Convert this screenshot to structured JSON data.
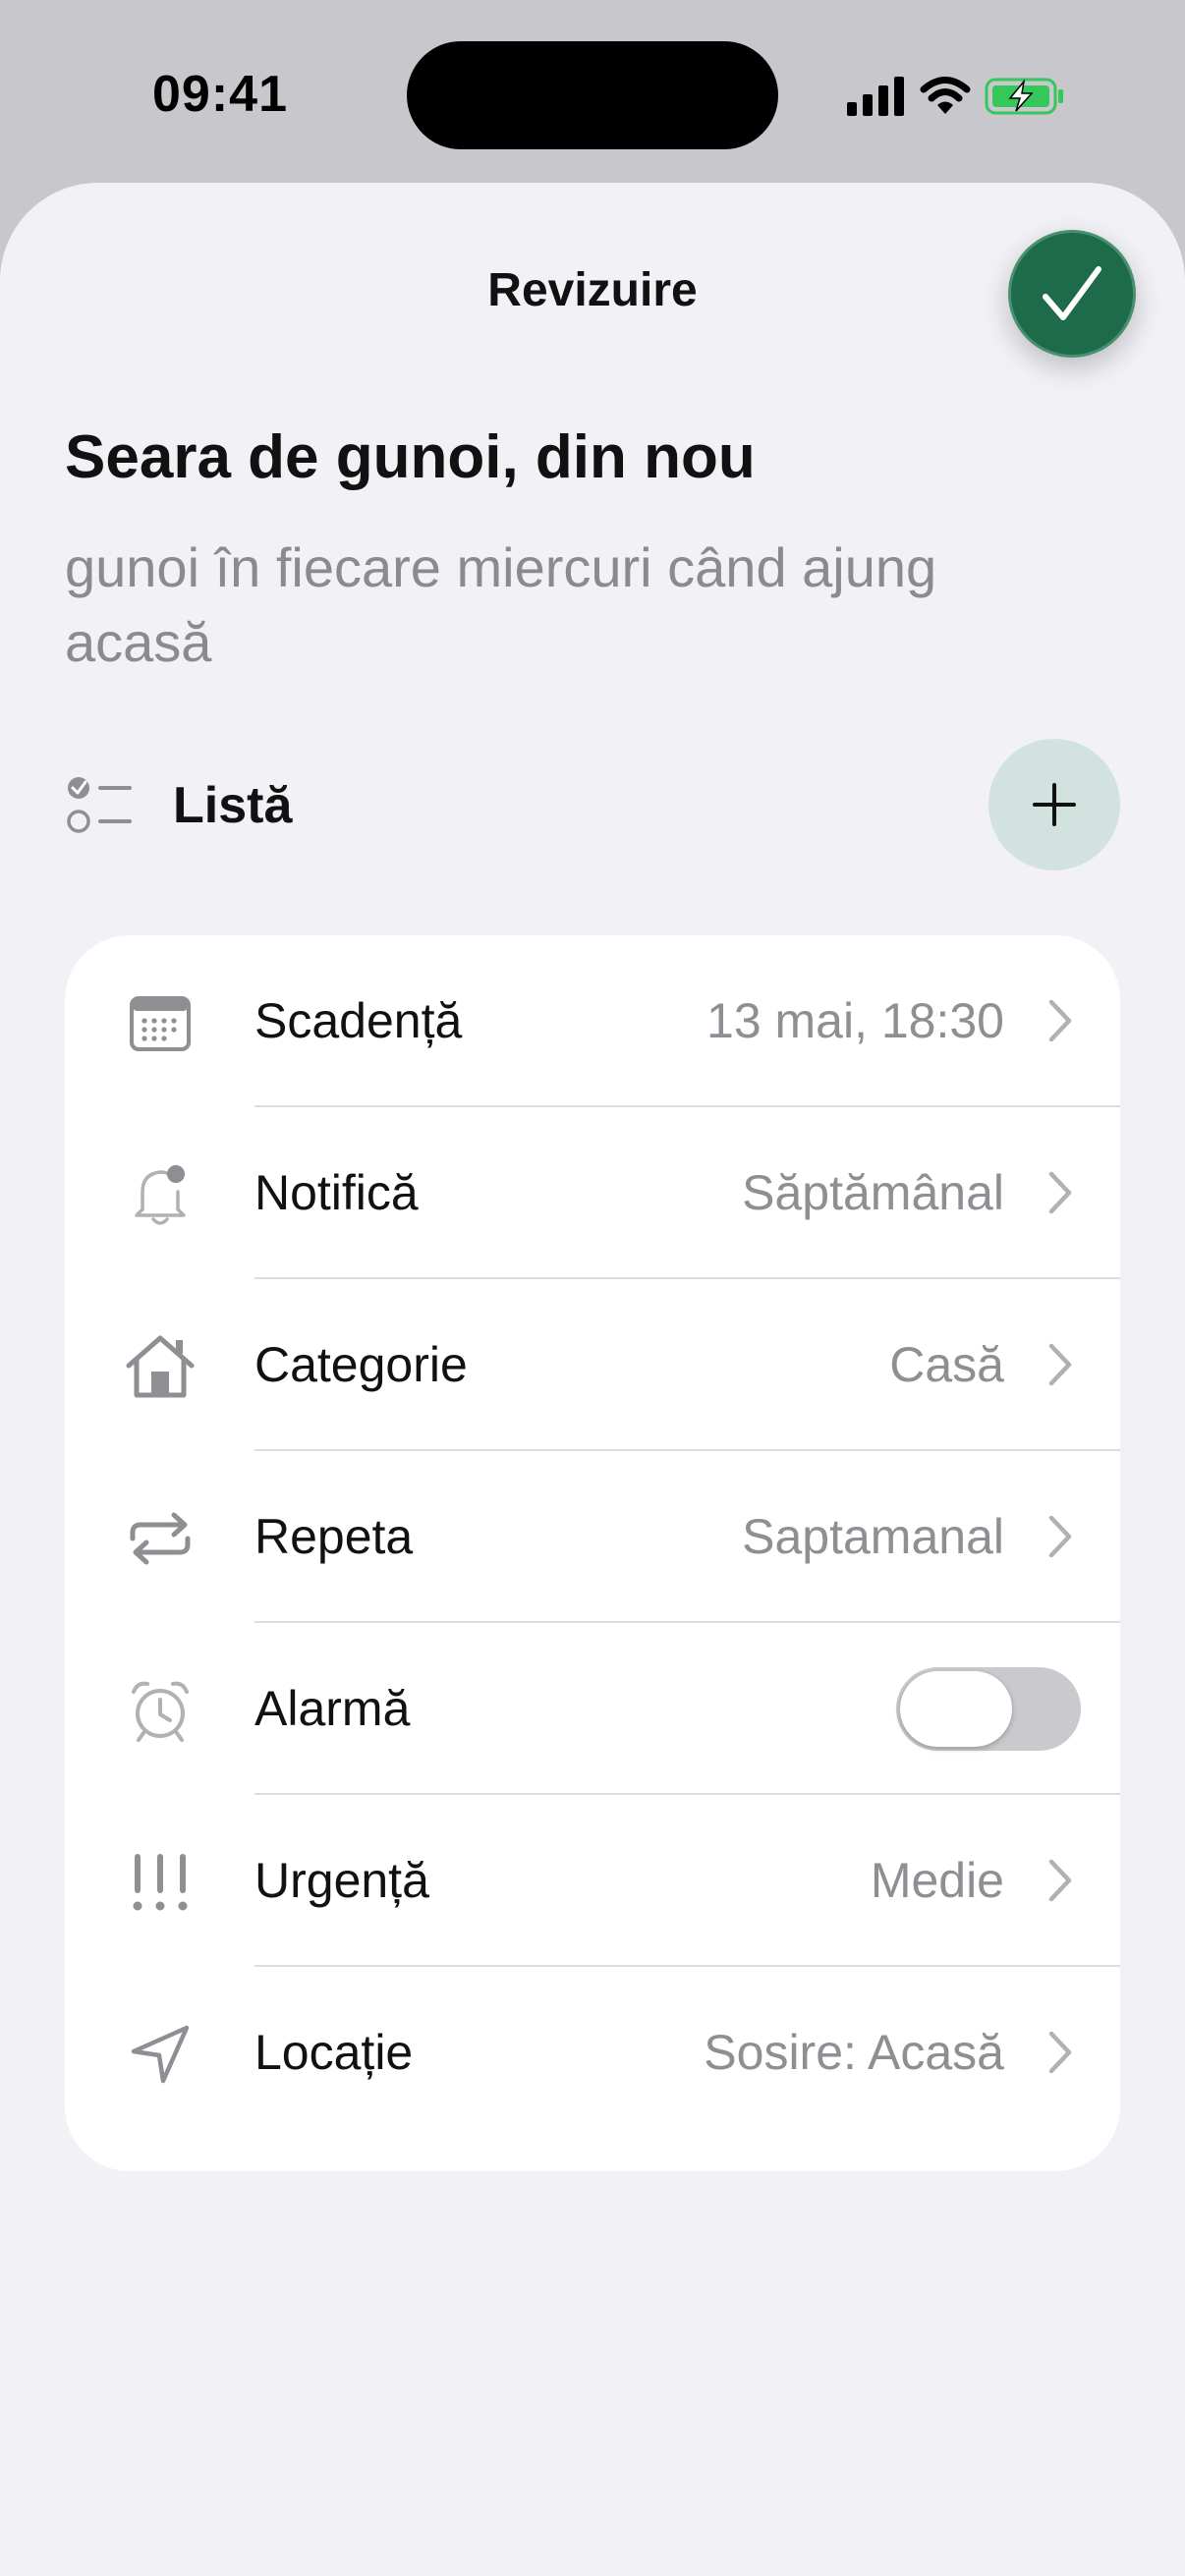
{
  "status_bar": {
    "time": "09:41",
    "icons": [
      "cellular-signal-icon",
      "wifi-icon",
      "battery-charging-icon"
    ],
    "battery_color": "#34c759"
  },
  "header": {
    "title": "Revizuire",
    "done_icon": "checkmark-icon",
    "accent_color": "#1e6b4c"
  },
  "task": {
    "title": "Seara de gunoi, din nou",
    "note": "gunoi în fiecare miercuri când ajung acasă"
  },
  "list": {
    "icon": "checklist-icon",
    "label": "Listă",
    "add_icon": "plus-icon"
  },
  "settings": [
    {
      "icon": "calendar-icon",
      "label": "Scadență",
      "value": "13 mai, 18:30",
      "type": "disclosure"
    },
    {
      "icon": "bell-badge-icon",
      "label": "Notifică",
      "value": "Săptămânal",
      "type": "disclosure"
    },
    {
      "icon": "house-icon",
      "label": "Categorie",
      "value": "Casă",
      "type": "disclosure"
    },
    {
      "icon": "repeat-icon",
      "label": "Repeta",
      "value": "Saptamanal",
      "type": "disclosure"
    },
    {
      "icon": "alarm-clock-icon",
      "label": "Alarmă",
      "value": "",
      "type": "toggle",
      "on": false
    },
    {
      "icon": "exclamation-icon",
      "label": "Urgență",
      "value": "Medie",
      "type": "disclosure"
    },
    {
      "icon": "location-arrow-icon",
      "label": "Locație",
      "value": "Sosire: Acasă",
      "type": "disclosure"
    }
  ]
}
